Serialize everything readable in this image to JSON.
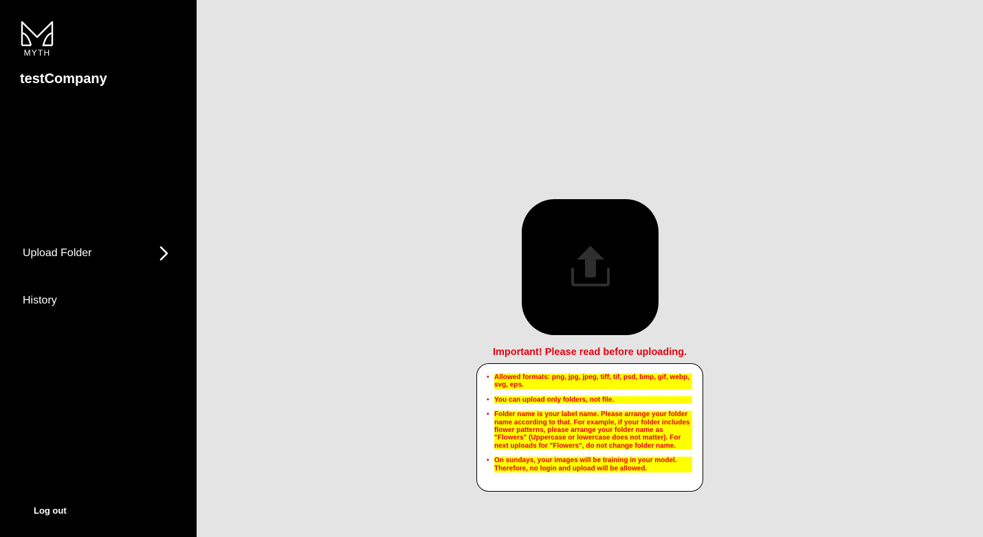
{
  "sidebar": {
    "logo_text": "MYTH",
    "company_name": "testCompany",
    "nav": [
      {
        "label": "Upload Folder"
      },
      {
        "label": "History"
      }
    ],
    "logout_label": "Log out"
  },
  "main": {
    "upload_icon": "upload-icon",
    "important_title": "Important! Please read before uploading.",
    "rules": [
      "Allowed formats: png, jpg, jpeg, tiff, tif, psd, bmp, gif, webp, svg, eps.",
      "You can upload only folders, not file.",
      "Folder name is your label name. Please arrange your folder name according to that. For example, if your folder includes flower patterns, please arrange your folder name as \"Flowers\" (Uppercase or lowercase does not matter). For next uploads for \"Flowers\", do not change folder name.",
      "On sundays, your images will be training in your model. Therefore, no login and upload will be allowed."
    ]
  },
  "colors": {
    "sidebar_bg": "#000000",
    "main_bg": "#e4e4e4",
    "warning_text": "#e3000f",
    "highlight": "#ffff00"
  }
}
